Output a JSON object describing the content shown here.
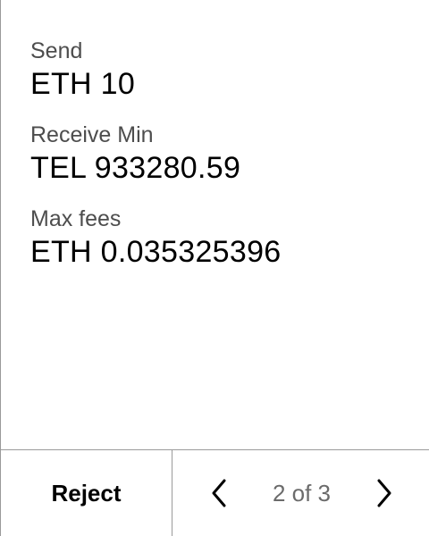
{
  "details": {
    "send": {
      "label": "Send",
      "value": "ETH 10"
    },
    "receive_min": {
      "label": "Receive Min",
      "value": "TEL 933280.59"
    },
    "max_fees": {
      "label": "Max fees",
      "value": "ETH 0.035325396"
    }
  },
  "footer": {
    "reject_label": "Reject",
    "page_indicator": "2 of 3",
    "prev_icon": "chevron-left-icon",
    "next_icon": "chevron-right-icon"
  }
}
